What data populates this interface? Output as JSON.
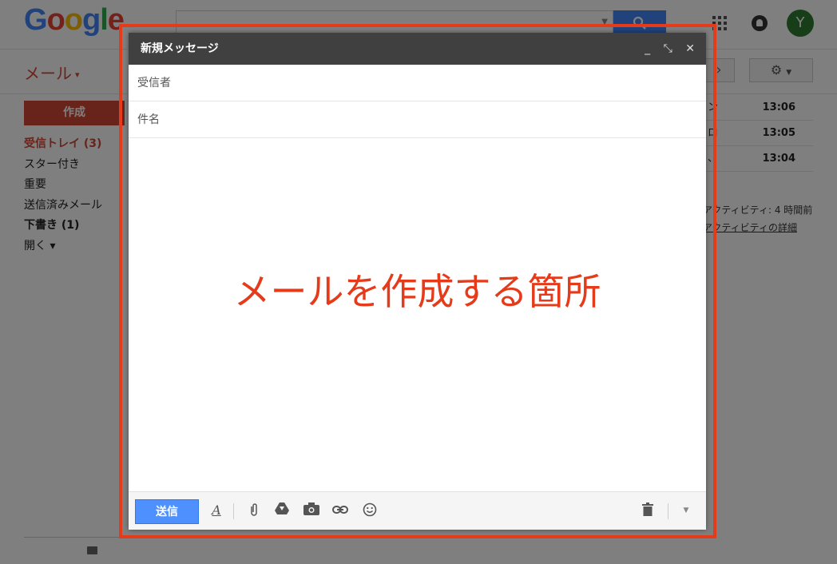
{
  "brand": {
    "logo_letters": [
      "G",
      "o",
      "o",
      "g",
      "l",
      "e"
    ]
  },
  "header": {
    "avatar_initial": "Y",
    "mail_label": "メール",
    "mail_caret": "▾"
  },
  "sidebar": {
    "compose_label": "作成",
    "items": [
      {
        "label": "受信トレイ (3)"
      },
      {
        "label": "スター付き"
      },
      {
        "label": "重要"
      },
      {
        "label": "送信済みメール"
      },
      {
        "label": "下書き (1)"
      },
      {
        "label": "開く ▾"
      }
    ]
  },
  "inbox": {
    "times": [
      "13:06",
      "13:05",
      "13:04"
    ],
    "fragments": [
      "ン",
      "ロ",
      "、"
    ],
    "activity_text": "アクティビティ: 4 時間前",
    "activity_link": "アクティビティの詳細"
  },
  "compose": {
    "title": "新規メッセージ",
    "to_placeholder": "受信者",
    "subject_placeholder": "件名",
    "send_label": "送信",
    "header_icons": [
      "minimize-icon",
      "fullscreen-icon",
      "close-icon"
    ]
  },
  "annotation": {
    "text": "メールを作成する箇所",
    "color": "#e53b1b"
  },
  "colors": {
    "accent_red": "#d14836",
    "send_blue": "#4d90fe",
    "header_dark": "#404040"
  }
}
